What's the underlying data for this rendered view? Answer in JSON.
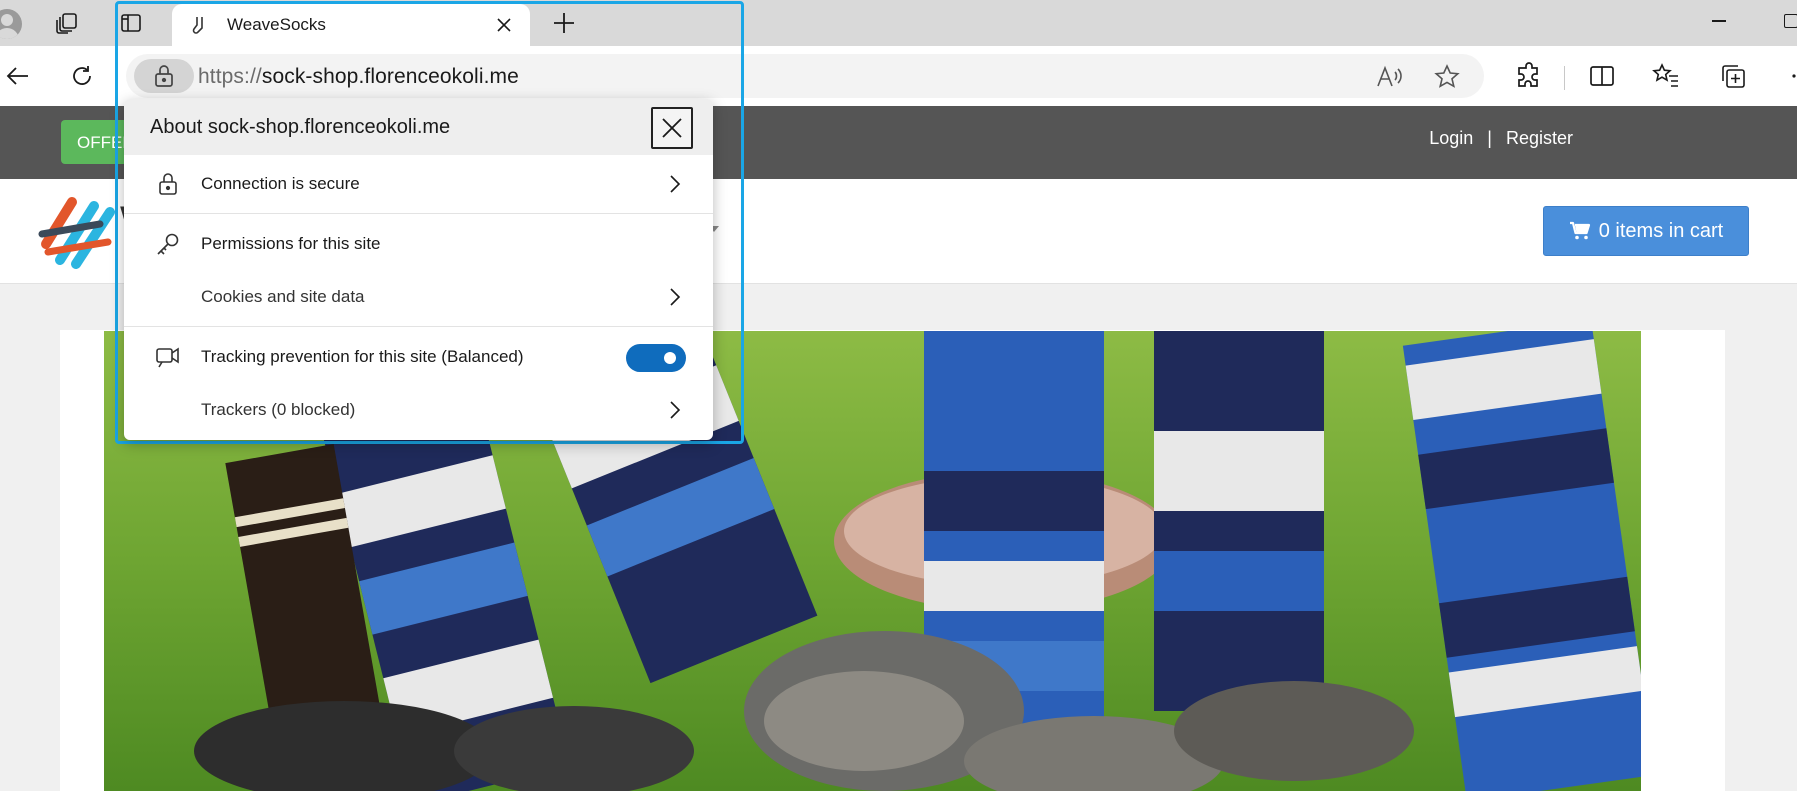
{
  "browser": {
    "tab_title": "WeaveSocks",
    "url_protocol": "https://",
    "url_host": "sock-shop.florenceokoli.me",
    "icons": [
      "profile-icon",
      "workspaces-icon",
      "vertical-tabs-icon",
      "sock-favicon",
      "close-icon",
      "new-tab-icon",
      "back-icon",
      "refresh-icon",
      "lock-icon",
      "read-aloud-icon",
      "favorite-star-icon",
      "extensions-icon",
      "split-screen-icon",
      "favorites-icon",
      "collections-icon",
      "more-icon",
      "minimize-icon",
      "maximize-icon"
    ]
  },
  "site_info": {
    "title": "About sock-shop.florenceokoli.me",
    "connection": "Connection is secure",
    "permissions": "Permissions for this site",
    "cookies": "Cookies and site data",
    "tracking": "Tracking prevention for this site (Balanced)",
    "tracking_enabled": true,
    "trackers": "Trackers (0 blocked)"
  },
  "page": {
    "offers_label": "OFFER",
    "login": "Login",
    "separator": "|",
    "register": "Register",
    "cart_label": "0 items in cart",
    "logo_text": "W",
    "colors": {
      "topbar": "#555555",
      "offers": "#5cb85c",
      "cart": "#4a8fdb",
      "toggle": "#0f6cbd",
      "focus": "#1aa6e6"
    }
  }
}
